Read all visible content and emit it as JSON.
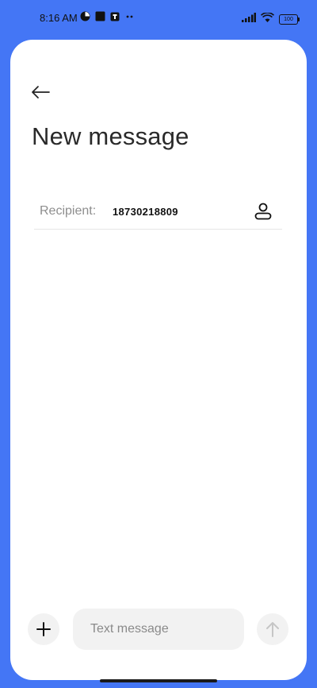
{
  "status_bar": {
    "time": "8:16 AM",
    "battery": "100",
    "left_icons": [
      "pinwheel-icon",
      "square-icon",
      "app-notification-icon",
      "more-dots-icon"
    ],
    "right_icons": [
      "signal-icon",
      "wifi-icon",
      "battery-icon"
    ]
  },
  "header": {
    "back_icon": "back-arrow-icon",
    "title": "New message"
  },
  "recipient": {
    "label": "Recipient:",
    "value": "18730218809",
    "contact_icon": "person-icon"
  },
  "composer": {
    "add_icon": "plus-icon",
    "placeholder": "Text message",
    "value": "",
    "send_icon": "arrow-up-icon"
  },
  "colors": {
    "background": "#4476f5",
    "card": "#ffffff",
    "input_bg": "#f2f2f2"
  }
}
